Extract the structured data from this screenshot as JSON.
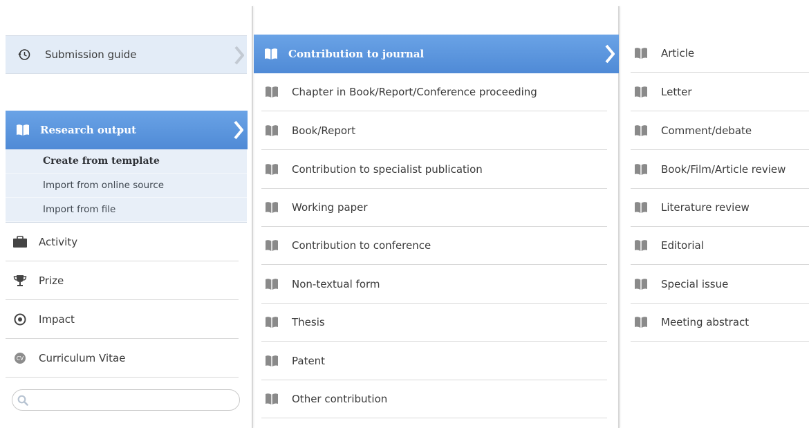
{
  "column1": {
    "submission_guide": {
      "label": "Submission guide",
      "icon": "history-icon"
    },
    "research_output": {
      "label": "Research output",
      "icon": "book-icon"
    },
    "research_submenu": [
      "Create from template",
      "Import from online source",
      "Import from file"
    ],
    "items": [
      {
        "label": "Activity",
        "icon": "briefcase-icon"
      },
      {
        "label": "Prize",
        "icon": "trophy-icon"
      },
      {
        "label": "Impact",
        "icon": "target-icon"
      },
      {
        "label": "Curriculum Vitae",
        "icon": "cv-icon"
      }
    ],
    "search": {
      "value": "",
      "placeholder": ""
    }
  },
  "column2": {
    "active": {
      "label": "Contribution to journal"
    },
    "items": [
      "Chapter in Book/Report/Conference proceeding",
      "Book/Report",
      "Contribution to specialist publication",
      "Working paper",
      "Contribution to conference",
      "Non-textual form",
      "Thesis",
      "Patent",
      "Other contribution"
    ]
  },
  "column3": {
    "items": [
      "Article",
      "Letter",
      "Comment/debate",
      "Book/Film/Article review",
      "Literature review",
      "Editorial",
      "Special issue",
      "Meeting abstract"
    ]
  },
  "colors": {
    "active_top": "#6aa3e6",
    "active_bottom": "#4f8ad6",
    "guide_bg": "#e3ecf7",
    "submenu_bg": "#e8eff8",
    "icon_gray": "#8a8a8a"
  }
}
